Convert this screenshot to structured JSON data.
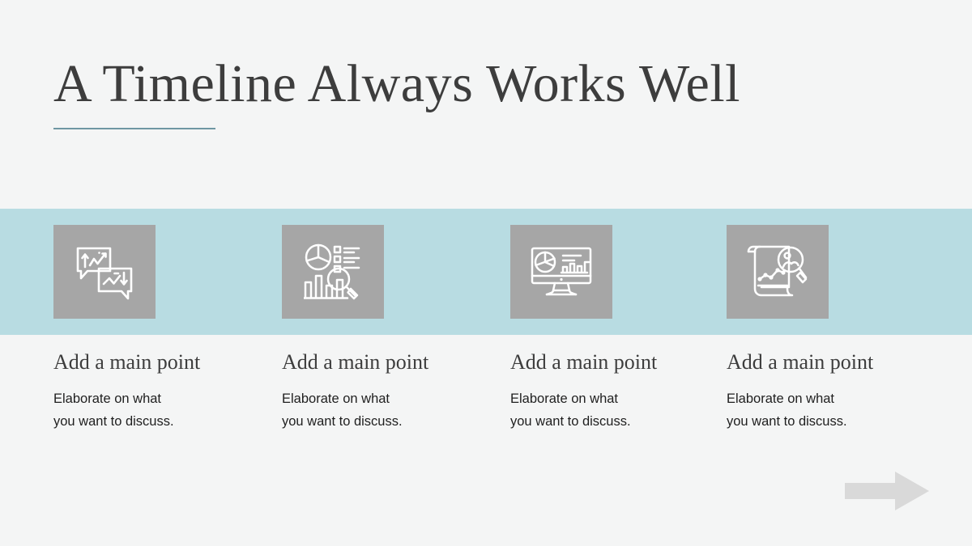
{
  "slide": {
    "title": "A Timeline Always Works Well",
    "background_color": "#f4f5f5",
    "band_color": "#b8dce2",
    "accent_color": "#6f97a3",
    "tile_color": "#a6a6a6",
    "title_color": "#3d3d3d",
    "arrow_color": "#d9d9d9"
  },
  "columns": [
    {
      "icon": "speech-bubbles-trend-charts-icon",
      "heading": "Add a main point",
      "body": "Elaborate on what\nyou want to discuss."
    },
    {
      "icon": "pie-bar-chart-magnifier-icon",
      "heading": "Add a main point",
      "body": "Elaborate on what\nyou want to discuss."
    },
    {
      "icon": "monitor-dashboard-icon",
      "heading": "Add a main point",
      "body": "Elaborate on what\nyou want to discuss."
    },
    {
      "icon": "scroll-line-chart-magnifier-icon",
      "heading": "Add a main point",
      "body": "Elaborate on what\nyou want to discuss."
    }
  ],
  "decor": {
    "arrow": "right-arrow-icon"
  }
}
